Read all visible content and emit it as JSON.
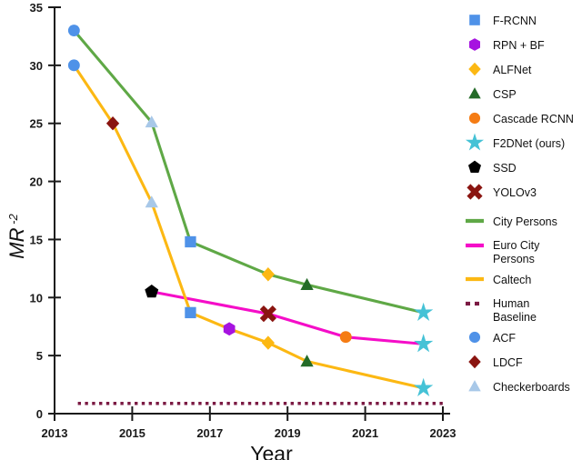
{
  "chart_data": {
    "type": "line",
    "title": "",
    "xlabel": "Year",
    "ylabel": "MR -2",
    "ylabel_base": "MR",
    "ylabel_exp": "-2",
    "xlim": [
      2013,
      2023
    ],
    "ylim": [
      0,
      35
    ],
    "xticks": [
      2013,
      2015,
      2017,
      2019,
      2021,
      2023
    ],
    "yticks": [
      0,
      5,
      10,
      15,
      20,
      25,
      30,
      35
    ],
    "xtick_labels": [
      "2013",
      "2015",
      "2017",
      "2019",
      "2021",
      "2023"
    ],
    "ytick_labels": [
      "0",
      "5",
      "10",
      "15",
      "20",
      "25",
      "30",
      "35"
    ],
    "grid": false,
    "legend_position": "right",
    "series": [
      {
        "name": "City Persons",
        "color": "#5fa846",
        "kind": "line",
        "points": [
          {
            "x": 2013.5,
            "y": 33.0,
            "marker": "ACF"
          },
          {
            "x": 2015.5,
            "y": 25.1,
            "marker": "Checkerboards"
          },
          {
            "x": 2016.5,
            "y": 14.8,
            "marker": "F-RCNN"
          },
          {
            "x": 2018.5,
            "y": 12.0,
            "marker": "ALFNet"
          },
          {
            "x": 2019.5,
            "y": 11.1,
            "marker": "CSP"
          },
          {
            "x": 2022.5,
            "y": 8.7,
            "marker": "F2DNet (ours)"
          }
        ]
      },
      {
        "name": "Euro City Persons",
        "color": "#f50dc8",
        "kind": "line",
        "points": [
          {
            "x": 2015.5,
            "y": 10.5,
            "marker": "SSD"
          },
          {
            "x": 2018.5,
            "y": 8.6,
            "marker": "YOLOv3"
          },
          {
            "x": 2020.5,
            "y": 6.6,
            "marker": "Cascade RCNN"
          },
          {
            "x": 2022.5,
            "y": 6.0,
            "marker": "F2DNet (ours)"
          }
        ]
      },
      {
        "name": "Caltech",
        "color": "#fcb813",
        "kind": "line",
        "points": [
          {
            "x": 2013.5,
            "y": 30.0,
            "marker": "ACF"
          },
          {
            "x": 2014.5,
            "y": 25.0,
            "marker": "LDCF"
          },
          {
            "x": 2015.5,
            "y": 18.2,
            "marker": "Checkerboards"
          },
          {
            "x": 2016.5,
            "y": 8.7,
            "marker": "F-RCNN"
          },
          {
            "x": 2017.5,
            "y": 7.3,
            "marker": "RPN + BF"
          },
          {
            "x": 2018.5,
            "y": 6.1,
            "marker": "ALFNet"
          },
          {
            "x": 2019.5,
            "y": 4.5,
            "marker": "CSP"
          },
          {
            "x": 2022.5,
            "y": 2.2,
            "marker": "F2DNet (ours)"
          }
        ]
      },
      {
        "name": "Human Baseline",
        "color": "#7b1a43",
        "kind": "dotted-line",
        "points": [
          {
            "x": 2013.6,
            "y": 0.88
          },
          {
            "x": 2023.0,
            "y": 0.88
          }
        ]
      }
    ]
  },
  "legend": {
    "items": [
      {
        "label": "F-RCNN",
        "marker": "square",
        "color": "#4f92e8"
      },
      {
        "label": "RPN + BF",
        "marker": "hexagon",
        "color": "#a613e0"
      },
      {
        "label": "ALFNet",
        "marker": "diamond",
        "color": "#fcb813"
      },
      {
        "label": "CSP",
        "marker": "triangle",
        "color": "#246b28"
      },
      {
        "label": "Cascade RCNN",
        "marker": "circle",
        "color": "#f57c14"
      },
      {
        "label": "F2DNet (ours)",
        "marker": "star",
        "color": "#45c2d6"
      },
      {
        "label": "SSD",
        "marker": "pentagon",
        "color": "#000000"
      },
      {
        "label": "YOLOv3",
        "marker": "cross",
        "color": "#8a1410"
      },
      {
        "label": "City Persons",
        "marker": "line",
        "color": "#5fa846"
      },
      {
        "label": "Euro City Persons",
        "marker": "line",
        "color": "#f50dc8",
        "label2": "Persons",
        "label1": "Euro City"
      },
      {
        "label": "Caltech",
        "marker": "line",
        "color": "#fcb813"
      },
      {
        "label": "Human Baseline",
        "marker": "dotted",
        "color": "#7b1a43",
        "label1": "Human",
        "label2": "Baseline"
      },
      {
        "label": "ACF",
        "marker": "circle",
        "color": "#4f92e8"
      },
      {
        "label": "LDCF",
        "marker": "diamond",
        "color": "#8a1410"
      },
      {
        "label": "Checkerboards",
        "marker": "triangle",
        "color": "#a8c8e8"
      }
    ]
  },
  "markers_style": {
    "ACF": {
      "shape": "circle",
      "color": "#4f92e8"
    },
    "LDCF": {
      "shape": "diamond",
      "color": "#8a1410"
    },
    "Checkerboards": {
      "shape": "triangle",
      "color": "#a8c8e8"
    },
    "F-RCNN": {
      "shape": "square",
      "color": "#4f92e8"
    },
    "RPN + BF": {
      "shape": "hexagon",
      "color": "#a613e0"
    },
    "ALFNet": {
      "shape": "diamond",
      "color": "#fcb813"
    },
    "CSP": {
      "shape": "triangle",
      "color": "#246b28"
    },
    "Cascade RCNN": {
      "shape": "circle",
      "color": "#f57c14"
    },
    "F2DNet (ours)": {
      "shape": "star",
      "color": "#45c2d6"
    },
    "SSD": {
      "shape": "pentagon",
      "color": "#000000"
    },
    "YOLOv3": {
      "shape": "cross",
      "color": "#8a1410"
    }
  }
}
